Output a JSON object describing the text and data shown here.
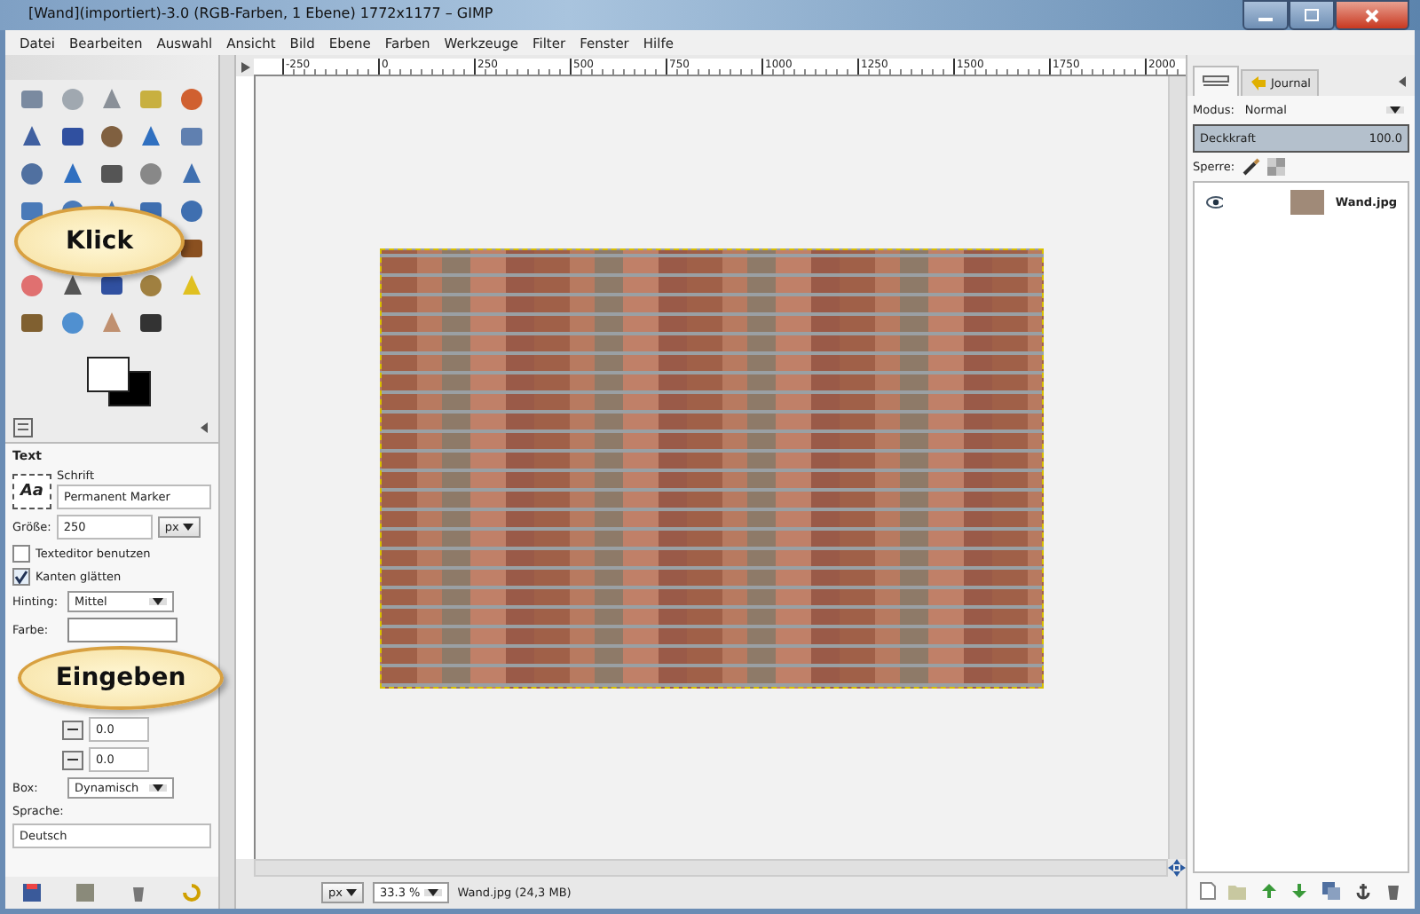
{
  "window": {
    "title": "[Wand](importiert)-3.0 (RGB-Farben, 1 Ebene) 1772x1177 – GIMP"
  },
  "menu": [
    "Datei",
    "Bearbeiten",
    "Auswahl",
    "Ansicht",
    "Bild",
    "Ebene",
    "Farben",
    "Werkzeuge",
    "Filter",
    "Fenster",
    "Hilfe"
  ],
  "tool_options": {
    "heading": "Text",
    "font_preview": "Aa",
    "font_label": "Schrift",
    "font": "Permanent Marker",
    "size_label": "Größe:",
    "size": "250",
    "unit": "px",
    "options": [
      {
        "label": "Texteditor benutzen",
        "checked": false
      },
      {
        "label": "Kanten glätten",
        "checked": true
      }
    ],
    "hinting_label": "Hinting:",
    "hinting": "Mittel",
    "color_label": "Farbe:",
    "spacing": [
      "0.0",
      "0.0"
    ],
    "box_label": "Box:",
    "box": "Dynamisch",
    "language_label": "Sprache:",
    "language": "Deutsch"
  },
  "ruler": {
    "labels": [
      "-250",
      "0",
      "250",
      "500",
      "750",
      "1000",
      "1250",
      "1500",
      "1750",
      "2000"
    ]
  },
  "status": {
    "unit": "px",
    "zoom": "33.3 %",
    "info": "Wand.jpg (24,3 MB)"
  },
  "layers": {
    "tab": "Journal",
    "mode_label": "Modus:",
    "mode": "Normal",
    "opacity_label": "Deckkraft",
    "opacity": "100.0",
    "level": 1.0,
    "lock_label": "Sperre:",
    "items": [
      {
        "name": "Wand.jpg",
        "visible": true
      }
    ]
  },
  "callouts": [
    "Klick",
    "Eingeben"
  ]
}
